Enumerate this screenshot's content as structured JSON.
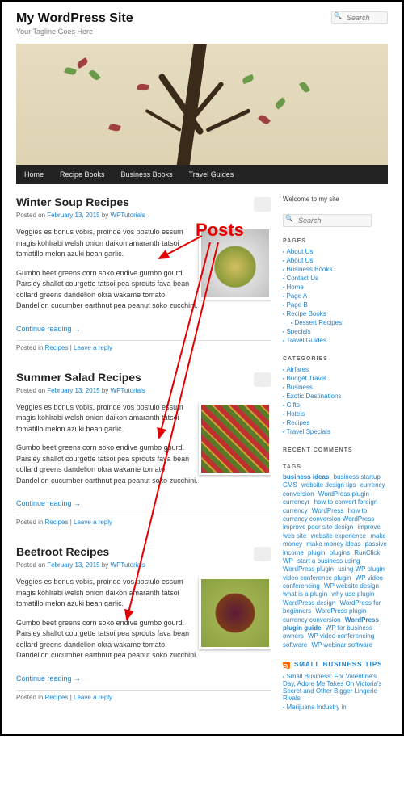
{
  "site": {
    "title": "My WordPress Site",
    "tagline": "Your Tagline Goes Here",
    "search_placeholder": "Search"
  },
  "nav": [
    {
      "label": "Home"
    },
    {
      "label": "Recipe Books"
    },
    {
      "label": "Business Books"
    },
    {
      "label": "Travel Guides"
    }
  ],
  "annotation": {
    "label": "Posts"
  },
  "posts": [
    {
      "title": "Winter Soup Recipes",
      "posted_on_prefix": "Posted on ",
      "date": "February 13, 2015",
      "by_prefix": " by ",
      "author": "WPTutorials",
      "para1": "Veggies es bonus vobis, proinde vos postulo essum magis kohlrabi welsh onion daikon amaranth tatsoi tomatillo melon azuki bean garlic.",
      "para2": "Gumbo beet greens corn soko endive gumbo gourd. Parsley shallot courgette tatsoi pea sprouts fava bean collard greens dandelion okra wakame tomato. Dandelion cucumber earthnut pea peanut soko zucchini.",
      "continue": "Continue reading →",
      "footer_prefix": "Posted in ",
      "category": "Recipes",
      "sep": " | ",
      "reply": "Leave a reply"
    },
    {
      "title": "Summer Salad Recipes",
      "posted_on_prefix": "Posted on ",
      "date": "February 13, 2015",
      "by_prefix": " by ",
      "author": "WPTutorials",
      "para1": "Veggies es bonus vobis, proinde vos postulo essum magis kohlrabi welsh onion daikon amaranth tatsoi tomatillo melon azuki bean garlic.",
      "para2": "Gumbo beet greens corn soko endive gumbo gourd. Parsley shallot courgette tatsoi pea sprouts fava bean collard greens dandelion okra wakame tomato. Dandelion cucumber earthnut pea peanut soko zucchini.",
      "continue": "Continue reading →",
      "footer_prefix": "Posted in ",
      "category": "Recipes",
      "sep": " | ",
      "reply": "Leave a reply"
    },
    {
      "title": "Beetroot Recipes",
      "posted_on_prefix": "Posted on ",
      "date": "February 13, 2015",
      "by_prefix": " by ",
      "author": "WPTutorials",
      "para1": "Veggies es bonus vobis, proinde vos postulo essum magis kohlrabi welsh onion daikon amaranth tatsoi tomatillo melon azuki bean garlic.",
      "para2": "Gumbo beet greens corn soko endive gumbo gourd. Parsley shallot courgette tatsoi pea sprouts fava bean collard greens dandelion okra wakame tomato. Dandelion cucumber earthnut pea peanut soko zucchini.",
      "continue": "Continue reading →",
      "footer_prefix": "Posted in ",
      "category": "Recipes",
      "sep": " | ",
      "reply": "Leave a reply"
    }
  ],
  "sidebar": {
    "welcome": "Welcome to my site",
    "pages_title": "PAGES",
    "pages": [
      "About Us",
      "About Us",
      "Business Books",
      "Contact Us",
      "Home",
      "Page A",
      "Page B",
      "Recipe Books",
      "Dessert Recipes",
      "Specials",
      "Travel Guides"
    ],
    "categories_title": "CATEGORIES",
    "categories": [
      "Airfares",
      "Budget Travel",
      "Business",
      "Exotic Destinations",
      "Gifts",
      "Hotels",
      "Recipes",
      "Travel Specials"
    ],
    "recent_comments_title": "RECENT COMMENTS",
    "tags_title": "TAGS",
    "tags": [
      {
        "t": "business ideas",
        "s": "tc-huge"
      },
      {
        "t": "business startup",
        "s": "tc-med"
      },
      {
        "t": "CMS",
        "s": "tc-sm"
      },
      {
        "t": "website design tips",
        "s": "tc-sm"
      },
      {
        "t": "currency conversion",
        "s": "tc-sm"
      },
      {
        "t": "WordPress plugin",
        "s": "tc-sm"
      },
      {
        "t": "currencyr",
        "s": "tc-sm"
      },
      {
        "t": "how to convert foreign currency",
        "s": "tc-sm"
      },
      {
        "t": "WordPress",
        "s": "tc-sm"
      },
      {
        "t": "how to currency conversion WordPress",
        "s": "tc-sm"
      },
      {
        "t": "improve poor site design",
        "s": "tc-sm"
      },
      {
        "t": "improve web site",
        "s": "tc-sm"
      },
      {
        "t": "website experience",
        "s": "tc-sm"
      },
      {
        "t": "make money",
        "s": "tc-sm"
      },
      {
        "t": "make money ideas",
        "s": "tc-sm"
      },
      {
        "t": "passive income",
        "s": "tc-sm"
      },
      {
        "t": "plugin",
        "s": "tc-sm"
      },
      {
        "t": "plugins",
        "s": "tc-sm"
      },
      {
        "t": "RunClick WP",
        "s": "tc-sm"
      },
      {
        "t": "start a business using WordPress plugin",
        "s": "tc-sm"
      },
      {
        "t": "using WP plugin",
        "s": "tc-sm"
      },
      {
        "t": "video conference plugin",
        "s": "tc-sm"
      },
      {
        "t": "WP video conferencing",
        "s": "tc-sm"
      },
      {
        "t": "WP website design",
        "s": "tc-sm"
      },
      {
        "t": "what is a plugin",
        "s": "tc-sm"
      },
      {
        "t": "why use plugin",
        "s": "tc-sm"
      },
      {
        "t": "WordPress design",
        "s": "tc-sm"
      },
      {
        "t": "WordPress for beginners",
        "s": "tc-sm"
      },
      {
        "t": "WordPress plugin",
        "s": "tc-sm"
      },
      {
        "t": "currency conversion",
        "s": "tc-sm"
      },
      {
        "t": "WordPress plugin guide",
        "s": "tc-huge"
      },
      {
        "t": "WP for business owners",
        "s": "tc-sm"
      },
      {
        "t": "WP video conferencing software",
        "s": "tc-sm"
      },
      {
        "t": "WP webinar software",
        "s": "tc-sm"
      }
    ],
    "rss_title": "SMALL BUSINESS TIPS",
    "rss_items": [
      "Small Business: For Valentine's Day, Adore Me Takes On Victoria's Secret and Other Bigger Lingerie Rivals",
      "Marijuana Industry in"
    ]
  }
}
